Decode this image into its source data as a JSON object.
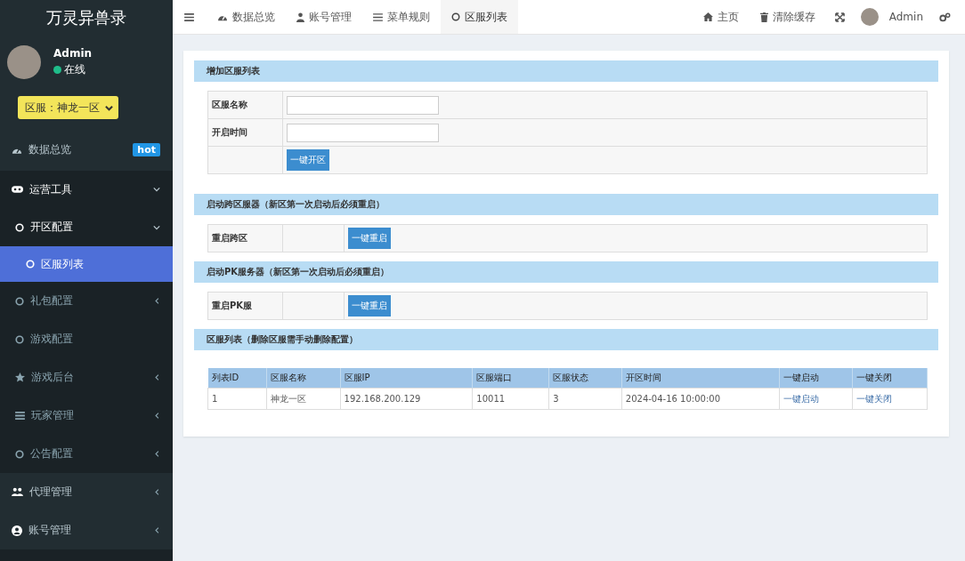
{
  "sidebar": {
    "title": "万灵异兽录",
    "user": {
      "name": "Admin",
      "status": "在线",
      "online": true
    },
    "server_select": {
      "value": "区服：神龙一区"
    },
    "items": [
      {
        "label": "数据总览",
        "badge": "hot",
        "expanded": false,
        "selected": false
      },
      {
        "label": "运营工具",
        "expanded": true,
        "selected": false,
        "children": [
          {
            "label": "开区配置",
            "expanded": true,
            "selected": false,
            "children": [
              {
                "label": "区服列表",
                "selected": true
              }
            ]
          },
          {
            "label": "礼包配置",
            "expanded": false,
            "selected": false
          },
          {
            "label": "游戏配置",
            "selected": false
          },
          {
            "label": "游戏后台",
            "expanded": false,
            "selected": false
          },
          {
            "label": "玩家管理",
            "expanded": false,
            "selected": false
          },
          {
            "label": "公告配置",
            "expanded": false,
            "selected": false
          }
        ]
      },
      {
        "label": "代理管理",
        "expanded": false,
        "selected": false
      },
      {
        "label": "账号管理",
        "expanded": false,
        "selected": false
      }
    ]
  },
  "topbar": {
    "tabs": [
      {
        "label": "数据总览",
        "selected": false
      },
      {
        "label": "账号管理",
        "selected": false
      },
      {
        "label": "菜单规则",
        "selected": false
      },
      {
        "label": "区服列表",
        "selected": true
      }
    ],
    "links": [
      "主页",
      "清除缓存"
    ],
    "user": "Admin"
  },
  "add_section": {
    "title": "增加区服列表",
    "fields": [
      {
        "label": "区服名称"
      },
      {
        "label": "开启时间"
      }
    ],
    "button": "一键开区"
  },
  "restart_sections": [
    {
      "title": "启动跨区服器（新区第一次启动后必须重启）",
      "label": "重启跨区",
      "button": "一键重启"
    },
    {
      "title": "启动PK服务器（新区第一次启动后必须重启）",
      "label": "重启PK服",
      "button": "一键重启"
    }
  ],
  "list_section": {
    "title": "区服列表（删除区服需手动删除配置）",
    "table": {
      "columns": [
        "列表ID",
        "区服名称",
        "区服IP",
        "区服端口",
        "区服状态",
        "开区时间",
        "一键启动",
        "一键关闭"
      ],
      "rows": [
        {
          "cells": [
            "1",
            "神龙一区",
            "192.168.200.129",
            "10011",
            "3",
            "2024-04-16 10:00:00"
          ],
          "start": "一键启动",
          "stop": "一键关闭"
        }
      ]
    }
  }
}
